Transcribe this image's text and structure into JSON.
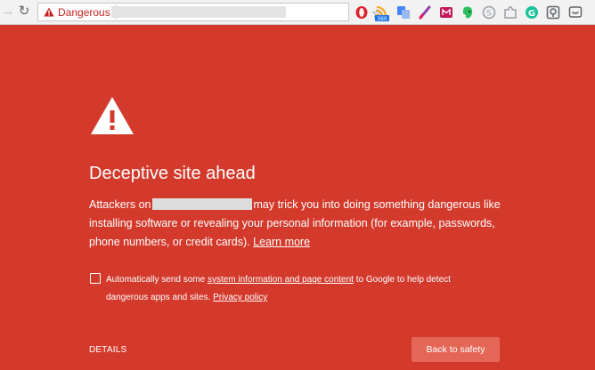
{
  "browser": {
    "security_chip_label": "Dangerous",
    "extensions": [
      "opera-icon",
      "rss-360-icon",
      "translate-icon",
      "pen-icon",
      "mail-icon",
      "evernote-icon",
      "skype-icon",
      "puzzle-icon",
      "grammarly-icon",
      "pocket-icon",
      "chat-icon"
    ],
    "badge_text": "360"
  },
  "interstitial": {
    "title": "Deceptive site ahead",
    "body_prefix": "Attackers on",
    "body_suffix": "may trick you into doing something dangerous like installing software or revealing your personal information (for example, passwords, phone numbers, or credit cards).",
    "learn_more": "Learn more",
    "report_prefix": "Automatically send some",
    "report_link": "system information and page content",
    "report_middle": "to Google to help detect dangerous apps and sites.",
    "privacy_link": "Privacy policy",
    "details_label": "DETAILS",
    "back_label": "Back to safety",
    "report_checked": false
  },
  "colors": {
    "background": "#d33a2c",
    "button": "#e46657",
    "chip_text": "#c5221f"
  }
}
